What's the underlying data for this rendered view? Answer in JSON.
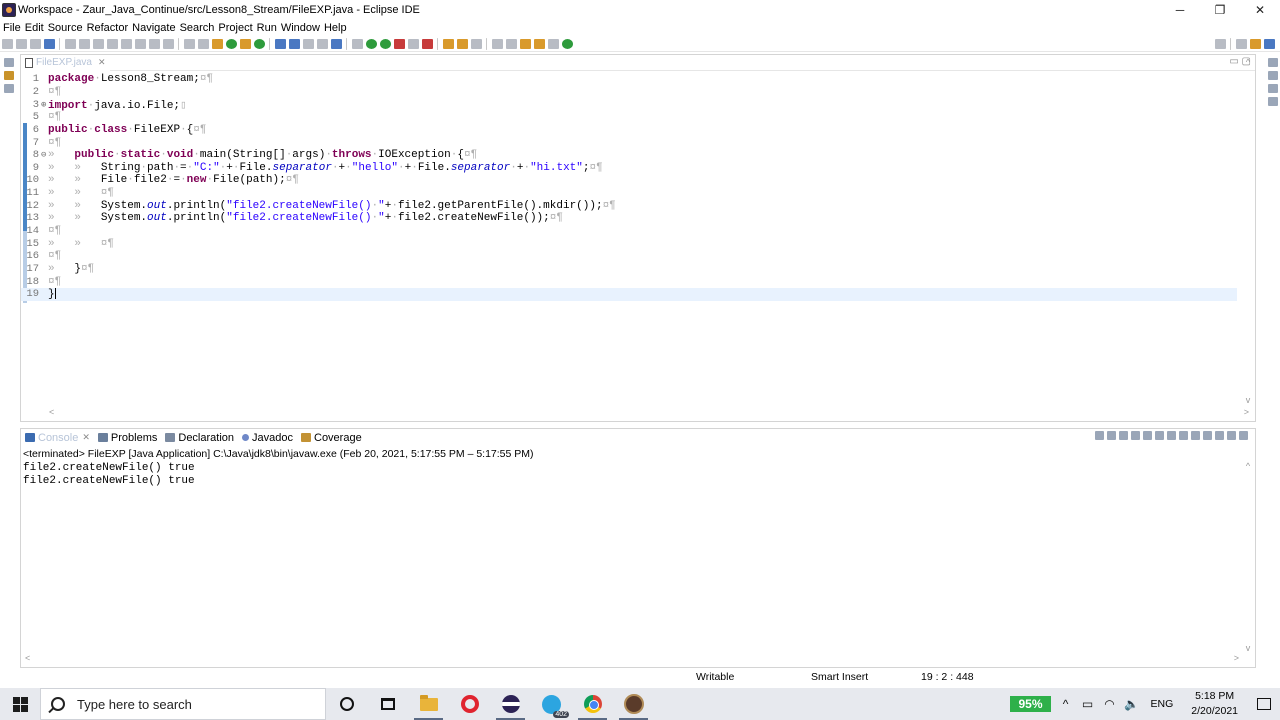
{
  "window": {
    "title": "Workspace - Zaur_Java_Continue/src/Lesson8_Stream/FileEXP.java - Eclipse IDE",
    "minimize_glyph": "─",
    "restore_glyph": "❐",
    "close_glyph": "✕"
  },
  "menu": [
    "File",
    "Edit",
    "Source",
    "Refactor",
    "Navigate",
    "Search",
    "Project",
    "Run",
    "Window",
    "Help"
  ],
  "editor": {
    "tab_label": "FileEXP.java",
    "tab_close": "✕",
    "minmax": "▭ ▢",
    "scroll_left": "<",
    "scroll_right": ">",
    "scroll_up": "^",
    "scroll_down": "v"
  },
  "code_lines": [
    {
      "n": "1",
      "fold": "",
      "html": "<span class=\"kw\">package</span><span class=\"ws\">·</span>Lesson8_Stream;<span class=\"ws\">¤¶</span>"
    },
    {
      "n": "2",
      "fold": "",
      "html": "<span class=\"ws\">¤¶</span>"
    },
    {
      "n": "3",
      "fold": "⊕",
      "html": "<span class=\"kw\">import</span><span class=\"ws\">·</span>java.io.File;<span class=\"ws\">▯</span>"
    },
    {
      "n": "5",
      "fold": "",
      "html": "<span class=\"ws\">¤¶</span>"
    },
    {
      "n": "6",
      "fold": "",
      "html": "<span class=\"kw\">public</span><span class=\"ws\">·</span><span class=\"kw\">class</span><span class=\"ws\">·</span>FileEXP<span class=\"ws\">·</span>{<span class=\"ws\">¤¶</span>"
    },
    {
      "n": "7",
      "fold": "",
      "html": "<span class=\"ws\">¤¶</span>"
    },
    {
      "n": "8",
      "fold": "⊖",
      "html": "<span class=\"ws\">»   </span><span class=\"kw\">public</span><span class=\"ws\">·</span><span class=\"kw\">static</span><span class=\"ws\">·</span><span class=\"kw\">void</span><span class=\"ws\">·</span>main(String[]<span class=\"ws\">·</span>args)<span class=\"ws\">·</span><span class=\"kw\">throws</span><span class=\"ws\">·</span>IOException<span class=\"ws\">·</span>{<span class=\"ws\">¤¶</span>"
    },
    {
      "n": "9",
      "fold": "",
      "html": "<span class=\"ws\">»   »   </span>String<span class=\"ws\">·</span>path<span class=\"ws\">·</span>=<span class=\"ws\">·</span><span class=\"str\">\"C:\"</span><span class=\"ws\">·</span>+<span class=\"ws\">·</span>File.<span class=\"fld\">separator</span><span class=\"ws\">·</span>+<span class=\"ws\">·</span><span class=\"str\">\"hello\"</span><span class=\"ws\">·</span>+<span class=\"ws\">·</span>File.<span class=\"fld\">separator</span><span class=\"ws\">·</span>+<span class=\"ws\">·</span><span class=\"str\">\"hi.txt\"</span>;<span class=\"ws\">¤¶</span>"
    },
    {
      "n": "10",
      "fold": "",
      "html": "<span class=\"ws\">»   »   </span>File<span class=\"ws\">·</span>file2<span class=\"ws\">·</span>=<span class=\"ws\">·</span><span class=\"kw\">new</span><span class=\"ws\">·</span>File(path);<span class=\"ws\">¤¶</span>"
    },
    {
      "n": "11",
      "fold": "",
      "html": "<span class=\"ws\">»   »   ¤¶</span>"
    },
    {
      "n": "12",
      "fold": "",
      "html": "<span class=\"ws\">»   »   </span>System.<span class=\"fld\">out</span>.println(<span class=\"str\">\"file2.createNewFile()<span class=\"ws\">·</span>\"</span>+<span class=\"ws\">·</span>file2.getParentFile().mkdir());<span class=\"ws\">¤¶</span>"
    },
    {
      "n": "13",
      "fold": "",
      "html": "<span class=\"ws\">»   »   </span>System.<span class=\"fld\">out</span>.println(<span class=\"str\">\"file2.createNewFile()<span class=\"ws\">·</span>\"</span>+<span class=\"ws\">·</span>file2.createNewFile());<span class=\"ws\">¤¶</span>"
    },
    {
      "n": "14",
      "fold": "",
      "html": "<span class=\"ws\">¤¶</span>"
    },
    {
      "n": "15",
      "fold": "",
      "html": "<span class=\"ws\">»   »   ¤¶</span>"
    },
    {
      "n": "16",
      "fold": "",
      "html": "<span class=\"ws\">¤¶</span>"
    },
    {
      "n": "17",
      "fold": "",
      "html": "<span class=\"ws\">»   </span>}<span class=\"ws\">¤¶</span>"
    },
    {
      "n": "18",
      "fold": "",
      "html": "<span class=\"ws\">¤¶</span>"
    },
    {
      "n": "19",
      "fold": "",
      "html": "}<span class=\"cursor\"></span>"
    }
  ],
  "panel": {
    "tabs": [
      {
        "label": "Console",
        "icon": "console-icon",
        "active": true,
        "close": "✕"
      },
      {
        "label": "Problems",
        "icon": "problems-icon",
        "active": false
      },
      {
        "label": "Declaration",
        "icon": "declaration-icon",
        "active": false
      },
      {
        "label": "Javadoc",
        "icon": "javadoc-icon",
        "active": false
      },
      {
        "label": "Coverage",
        "icon": "coverage-icon",
        "active": false
      }
    ],
    "console_header": "<terminated> FileEXP [Java Application] C:\\Java\\jdk8\\bin\\javaw.exe  (Feb 20, 2021, 5:17:55 PM – 5:17:55 PM)",
    "console_output": [
      "file2.createNewFile() true",
      "file2.createNewFile() true"
    ],
    "scroll_up": "^",
    "scroll_down": "v",
    "scroll_left": "<",
    "scroll_right": ">"
  },
  "status": {
    "writable": "Writable",
    "insert_mode": "Smart Insert",
    "position": "19 : 2 : 448"
  },
  "taskbar": {
    "search_placeholder": "Type here to search",
    "telegram_badge": "402",
    "battery": "95%",
    "language": "ENG",
    "time": "5:18 PM",
    "date": "2/20/2021",
    "tray_chevron": "^",
    "tray_battery": "▭",
    "tray_wifi": "◠",
    "tray_volume": "🔈"
  }
}
